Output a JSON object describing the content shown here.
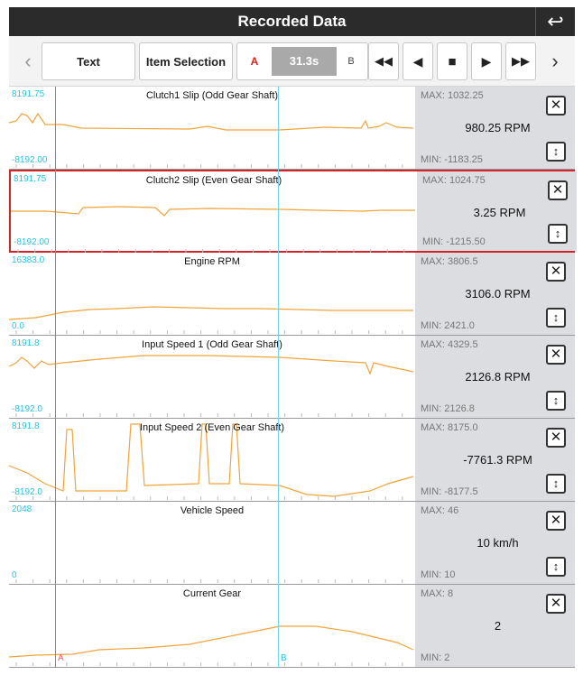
{
  "title": "Recorded Data",
  "toolbar": {
    "text_label": "Text",
    "item_selection_label": "Item Selection",
    "a_label": "A",
    "time": "31.3s",
    "b_label": "B"
  },
  "cursors": {
    "a_label": "A",
    "b_label": "B"
  },
  "panels": [
    {
      "name": "Clutch1 Slip (Odd Gear Shaft)",
      "ymax": "8191.75",
      "ymin": "-8192.00",
      "max": "MAX: 1032.25",
      "value": "980.25 RPM",
      "min": "MIN: -1183.25",
      "selected": false
    },
    {
      "name": "Clutch2 Slip (Even Gear Shaft)",
      "ymax": "8191.75",
      "ymin": "-8192.00",
      "max": "MAX: 1024.75",
      "value": "3.25 RPM",
      "min": "MIN: -1215.50",
      "selected": true
    },
    {
      "name": "Engine RPM",
      "ymax": "16383.0",
      "ymin": "0.0",
      "max": "MAX: 3806.5",
      "value": "3106.0 RPM",
      "min": "MIN: 2421.0",
      "selected": false
    },
    {
      "name": "Input Speed 1 (Odd Gear Shaft)",
      "ymax": "8191.8",
      "ymin": "-8192.0",
      "max": "MAX: 4329.5",
      "value": "2126.8 RPM",
      "min": "MIN: 2126.8",
      "selected": false
    },
    {
      "name": "Input Speed 2 (Even Gear Shaft)",
      "ymax": "8191.8",
      "ymin": "-8192.0",
      "max": "MAX: 8175.0",
      "value": "-7761.3 RPM",
      "min": "MIN: -8177.5",
      "selected": false
    },
    {
      "name": "Vehicle Speed",
      "ymax": "2048",
      "ymin": "0",
      "max": "MAX: 46",
      "value": "10 km/h",
      "min": "MIN: 10",
      "selected": false
    },
    {
      "name": "Current Gear",
      "ymax": "",
      "ymin": "",
      "max": "MAX: 8",
      "value": "2",
      "min": "MIN: 2",
      "selected": false
    }
  ],
  "colors": {
    "trace": "#f0a43a",
    "cursor_a": "#f0605a",
    "cursor_b": "#72d5e8",
    "selected_border": "#d0262a"
  }
}
